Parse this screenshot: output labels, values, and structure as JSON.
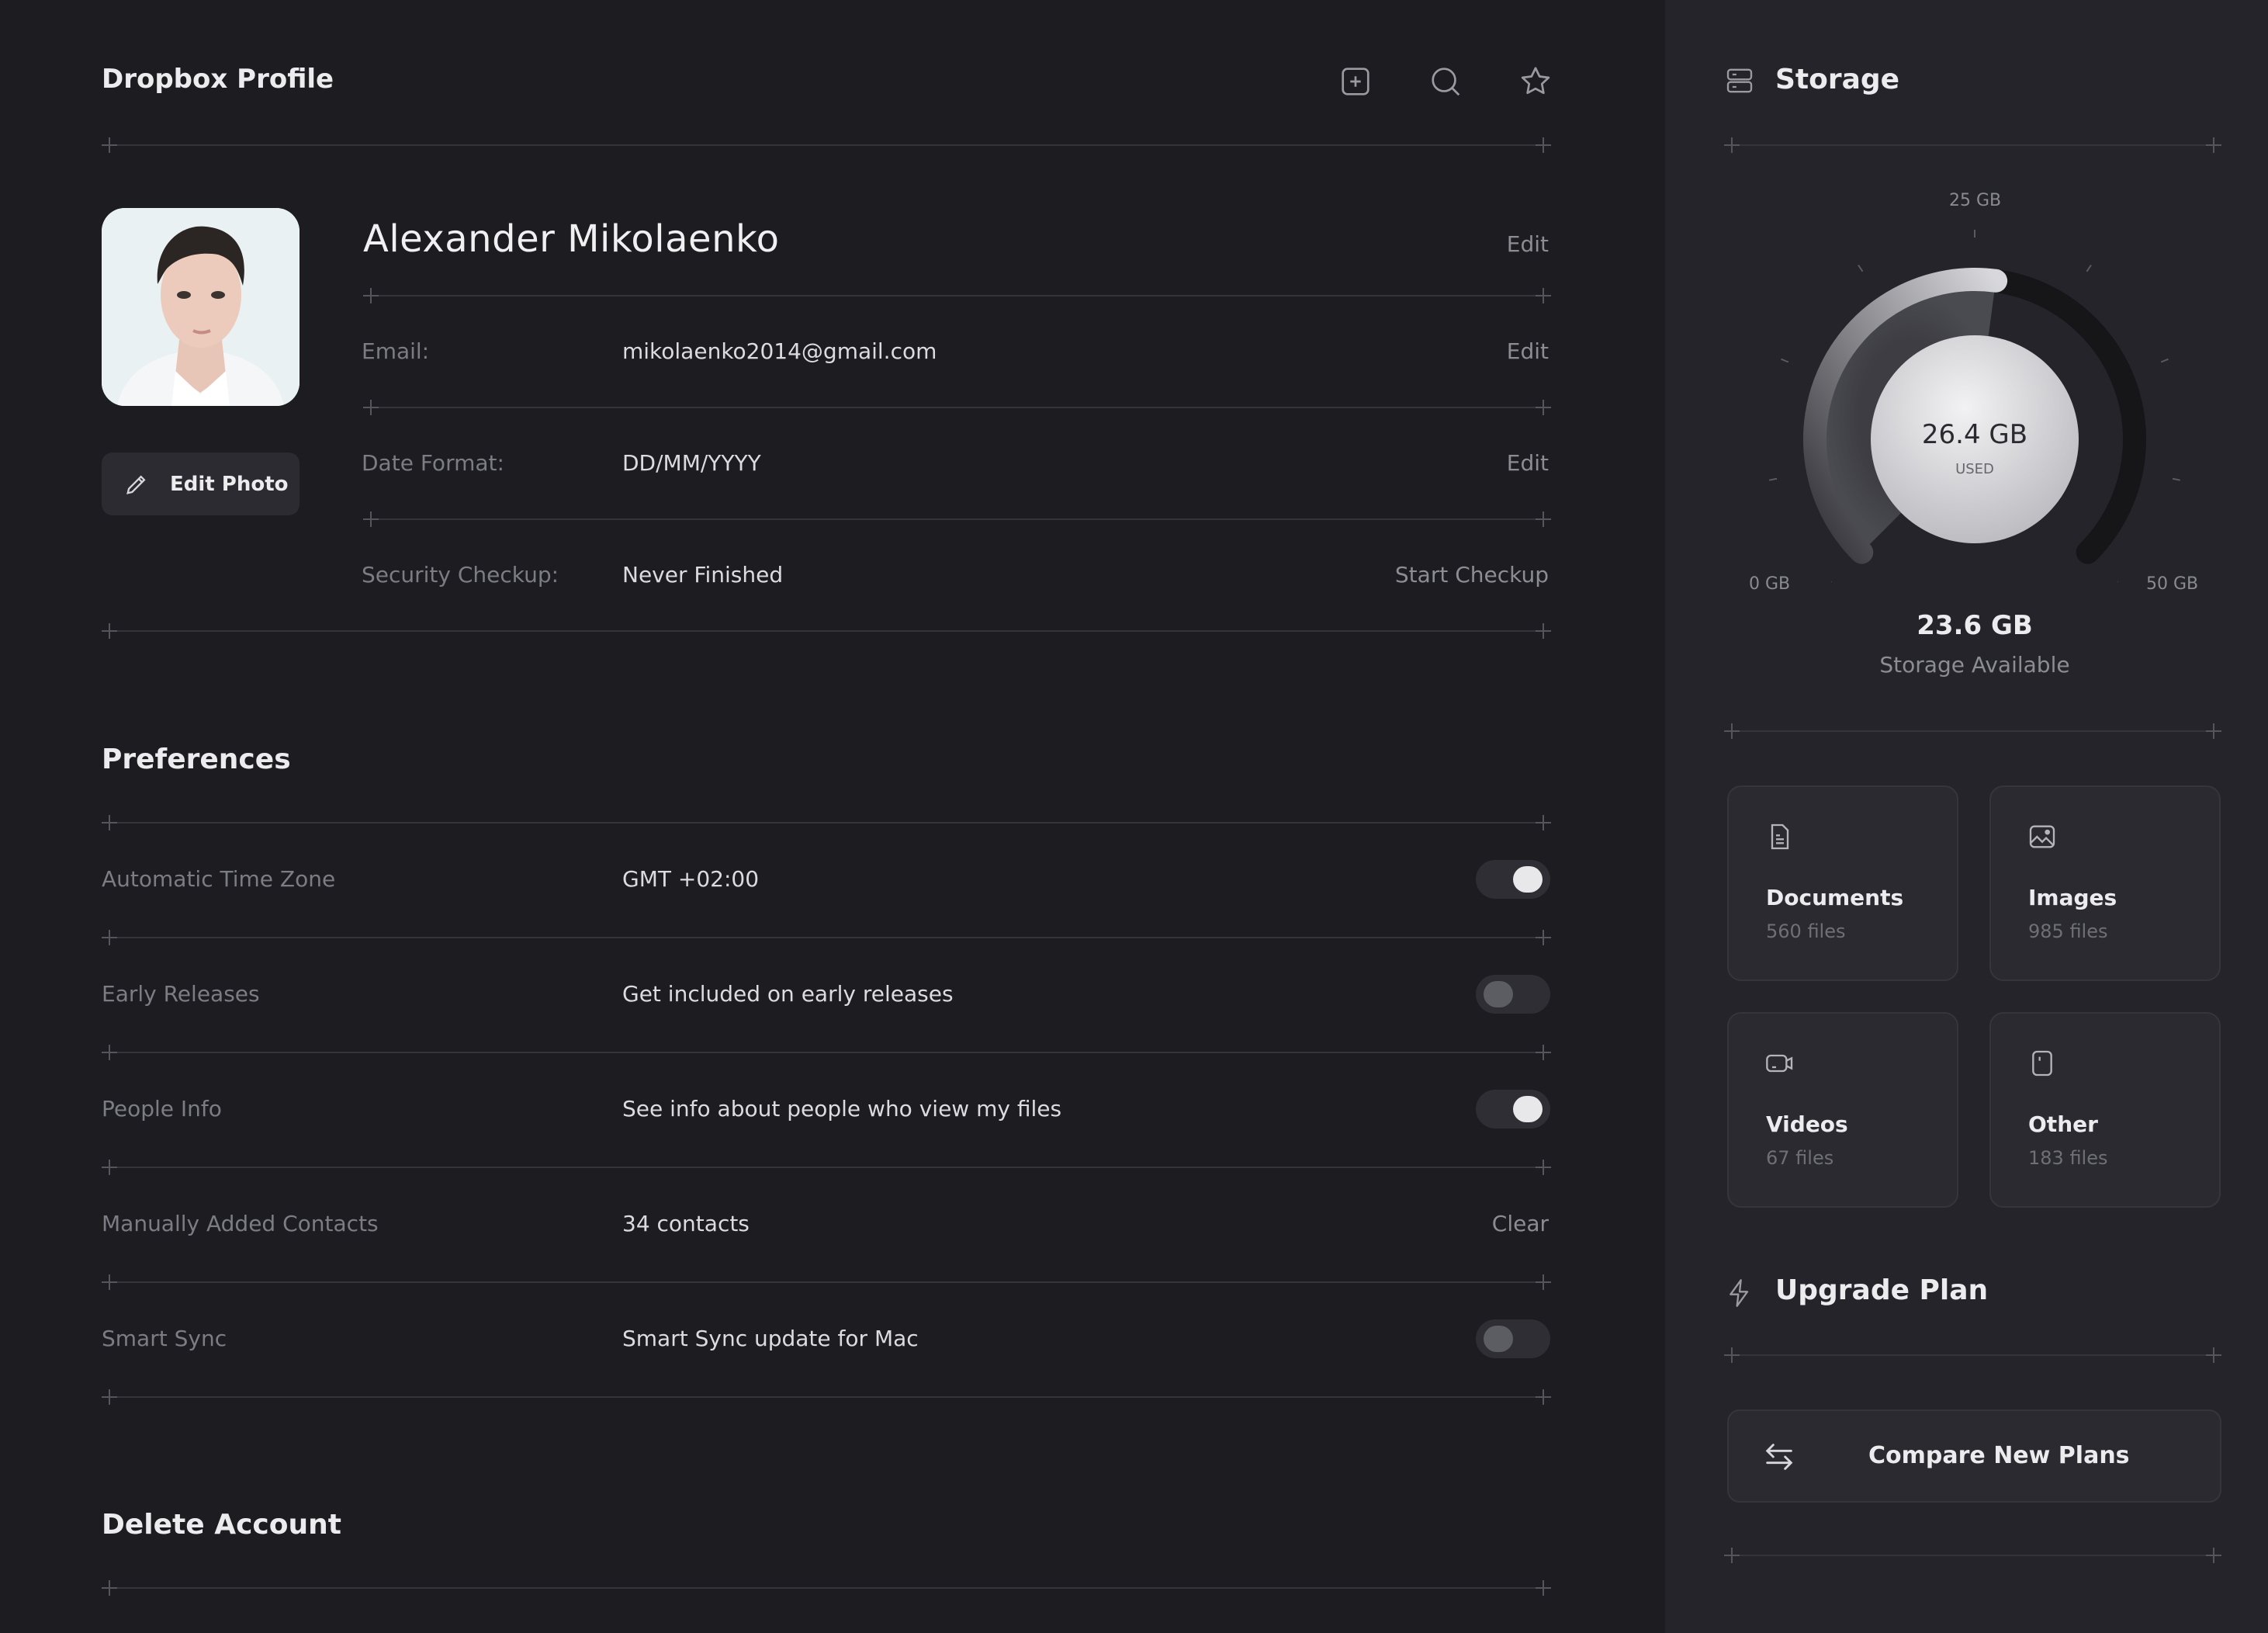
{
  "header": {
    "title": "Dropbox Profile",
    "icons": [
      "add-icon",
      "search-icon",
      "star-icon"
    ]
  },
  "profile": {
    "name": "Alexander Mikolaenko",
    "name_action": "Edit",
    "edit_photo_label": "Edit Photo",
    "rows": [
      {
        "label": "Email:",
        "value": "mikolaenko2014@gmail.com",
        "action": "Edit"
      },
      {
        "label": "Date Format:",
        "value": "DD/MM/YYYY",
        "action": "Edit"
      },
      {
        "label": "Security Checkup:",
        "value": "Never Finished",
        "action": "Start Checkup"
      }
    ]
  },
  "preferences": {
    "title": "Preferences",
    "rows": [
      {
        "label": "Automatic Time Zone",
        "value": "GMT +02:00",
        "control": "toggle",
        "on": true
      },
      {
        "label": "Early Releases",
        "value": "Get included on early releases",
        "control": "toggle",
        "on": false
      },
      {
        "label": "People Info",
        "value": "See info about people who view my files",
        "control": "toggle",
        "on": true
      },
      {
        "label": "Manually Added Contacts",
        "value": "34 contacts",
        "control": "link",
        "action": "Clear"
      },
      {
        "label": "Smart Sync",
        "value": "Smart Sync update for Mac",
        "control": "toggle",
        "on": false
      }
    ]
  },
  "delete_account": {
    "title": "Delete Account"
  },
  "storage": {
    "title": "Storage",
    "gauge": {
      "min_label": "0 GB",
      "mid_label": "25 GB",
      "max_label": "50 GB",
      "used_value": "26.4 GB",
      "used_label": "USED",
      "used_fraction": 0.528
    },
    "available_value": "23.6 GB",
    "available_label": "Storage Available",
    "categories": [
      {
        "name": "Documents",
        "count": "560 files",
        "icon": "document-icon"
      },
      {
        "name": "Images",
        "count": "985 files",
        "icon": "image-icon"
      },
      {
        "name": "Videos",
        "count": "67 files",
        "icon": "video-icon"
      },
      {
        "name": "Other",
        "count": "183 files",
        "icon": "file-icon"
      }
    ]
  },
  "upgrade": {
    "title": "Upgrade Plan",
    "button_label": "Compare  New Plans"
  },
  "colors": {
    "background": "#1c1c21",
    "sidebar": "#24242a",
    "text": "#ececef",
    "muted": "#7c7c84",
    "toggle_on_knob": "#e8e8ea",
    "toggle_off_knob": "#5c5c63"
  }
}
